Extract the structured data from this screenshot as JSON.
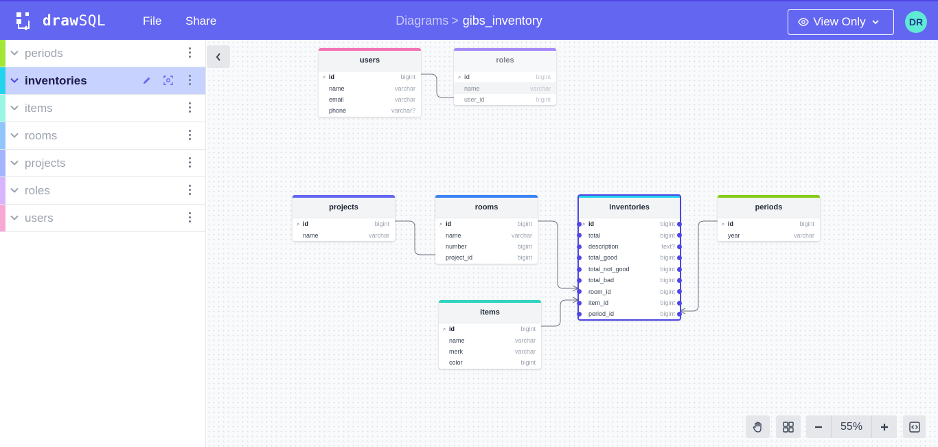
{
  "app": {
    "logo_bold": "draw",
    "logo_light": "SQL"
  },
  "menu": {
    "file": "File",
    "share": "Share"
  },
  "breadcrumb": {
    "parent": "Diagrams",
    "separator": ">",
    "current": "gibs_inventory"
  },
  "view_mode": {
    "label": "View Only"
  },
  "user": {
    "initials": "DR"
  },
  "sidebar": {
    "items": [
      {
        "label": "periods",
        "color": "#a3e635"
      },
      {
        "label": "inventories",
        "color": "#22d3ee",
        "active": true
      },
      {
        "label": "items",
        "color": "#99f6e4"
      },
      {
        "label": "rooms",
        "color": "#93c5fd"
      },
      {
        "label": "projects",
        "color": "#a5b4fc"
      },
      {
        "label": "roles",
        "color": "#d8b4fe"
      },
      {
        "label": "users",
        "color": "#f9a8d4"
      }
    ]
  },
  "tables": {
    "users": {
      "name": "users",
      "color": "#f472b6",
      "columns": [
        {
          "name": "id",
          "type": "bigint",
          "pk": true
        },
        {
          "name": "name",
          "type": "varchar"
        },
        {
          "name": "email",
          "type": "varchar"
        },
        {
          "name": "phone",
          "type": "varchar?"
        }
      ]
    },
    "roles": {
      "name": "roles",
      "color": "#a78bfa",
      "columns": [
        {
          "name": "id",
          "type": "bigint",
          "pk": true
        },
        {
          "name": "name",
          "type": "varchar"
        },
        {
          "name": "user_id",
          "type": "bigint"
        }
      ]
    },
    "projects": {
      "name": "projects",
      "color": "#6366f1",
      "columns": [
        {
          "name": "id",
          "type": "bigint",
          "pk": true
        },
        {
          "name": "name",
          "type": "varchar"
        }
      ]
    },
    "rooms": {
      "name": "rooms",
      "color": "#3b82f6",
      "columns": [
        {
          "name": "id",
          "type": "bigint",
          "pk": true
        },
        {
          "name": "name",
          "type": "varchar"
        },
        {
          "name": "number",
          "type": "bigint"
        },
        {
          "name": "project_id",
          "type": "bigint"
        }
      ]
    },
    "inventories": {
      "name": "inventories",
      "color": "#22d3ee",
      "columns": [
        {
          "name": "id",
          "type": "bigint",
          "pk": true
        },
        {
          "name": "total",
          "type": "bigint"
        },
        {
          "name": "description",
          "type": "text?"
        },
        {
          "name": "total_good",
          "type": "bigint"
        },
        {
          "name": "total_not_good",
          "type": "bigint"
        },
        {
          "name": "total_bad",
          "type": "bigint"
        },
        {
          "name": "room_id",
          "type": "bigint"
        },
        {
          "name": "item_id",
          "type": "bigint"
        },
        {
          "name": "period_id",
          "type": "bigint"
        }
      ]
    },
    "periods": {
      "name": "periods",
      "color": "#84cc16",
      "columns": [
        {
          "name": "id",
          "type": "bigint",
          "pk": true
        },
        {
          "name": "year",
          "type": "varchar"
        }
      ]
    },
    "items": {
      "name": "items",
      "color": "#2dd4bf",
      "columns": [
        {
          "name": "id",
          "type": "bigint",
          "pk": true
        },
        {
          "name": "name",
          "type": "varchar"
        },
        {
          "name": "merk",
          "type": "varchar"
        },
        {
          "name": "color",
          "type": "bigint"
        }
      ]
    }
  },
  "zoom": {
    "value": "55%"
  },
  "icons": {
    "hand": "hand-icon",
    "grid": "grid-icon",
    "minus": "minus-icon",
    "plus": "plus-icon",
    "code": "code-icon",
    "eye": "eye-icon",
    "chevron": "chevron-down-icon",
    "collapse": "chevron-left-icon",
    "key": "key-icon"
  }
}
